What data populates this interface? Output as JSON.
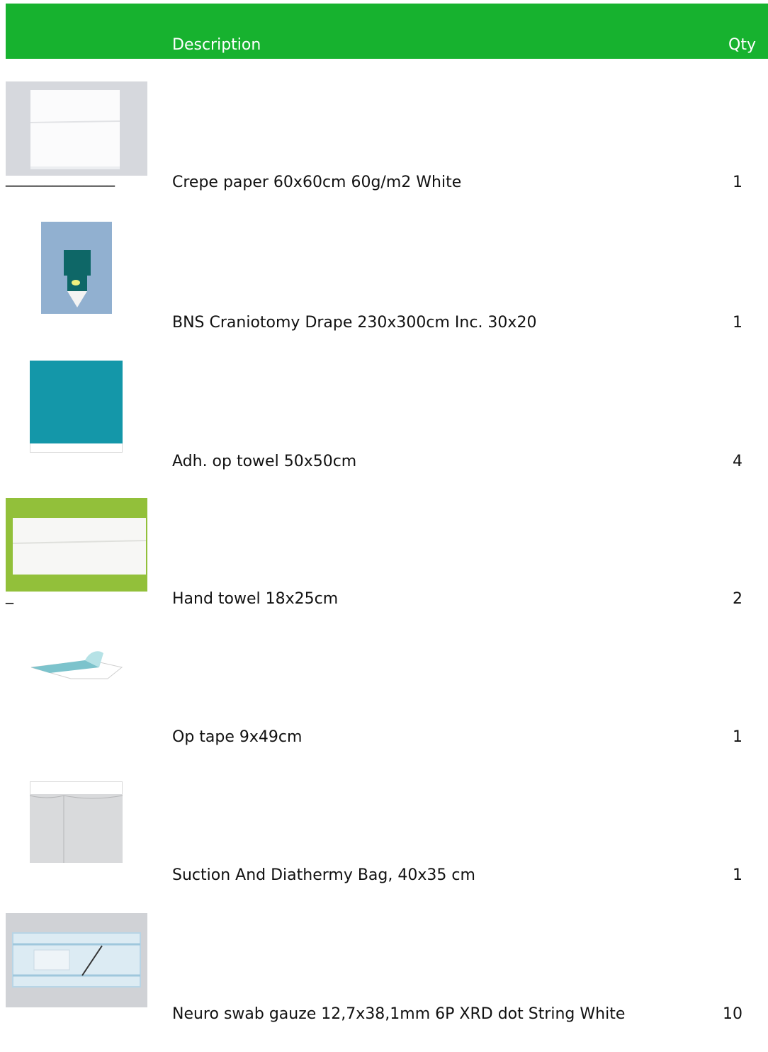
{
  "header": {
    "description": "Description",
    "qty": "Qty"
  },
  "items": [
    {
      "description": "Crepe paper 60x60cm 60g/m2 White",
      "qty": "1",
      "underline": "______________"
    },
    {
      "description": "BNS Craniotomy Drape 230x300cm Inc. 30x20",
      "qty": "1"
    },
    {
      "description": "Adh. op towel 50x50cm",
      "qty": "4"
    },
    {
      "description": "Hand towel 18x25cm",
      "qty": "2",
      "underline": "_"
    },
    {
      "description": "Op tape 9x49cm",
      "qty": "1"
    },
    {
      "description": "Suction And Diathermy Bag, 40x35 cm",
      "qty": "1"
    },
    {
      "description": "Neuro swab gauze 12,7x38,1mm 6P XRD dot String White",
      "qty": "10"
    }
  ],
  "colors": {
    "header_bg": "#17b22f",
    "header_text": "#ffffff"
  },
  "icons": [
    "crepe-paper-image",
    "craniotomy-drape-image",
    "op-towel-image",
    "hand-towel-image",
    "op-tape-image",
    "suction-bag-image",
    "neuro-swab-image"
  ]
}
